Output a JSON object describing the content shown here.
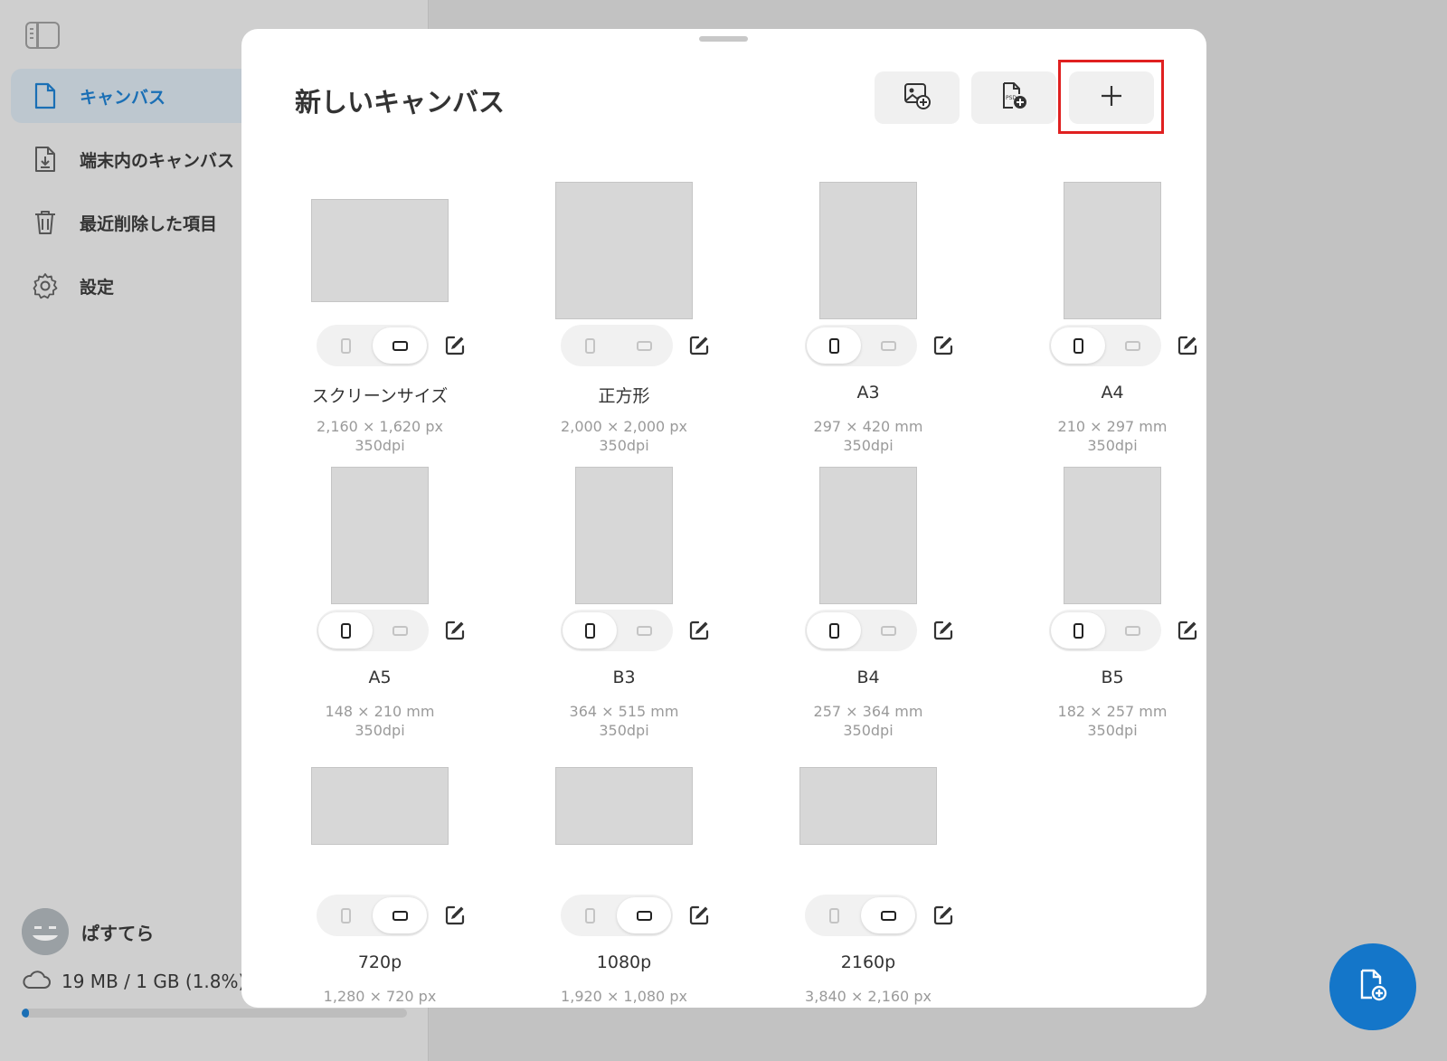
{
  "sidebar": {
    "items": [
      {
        "label": "キャンバス",
        "icon": "document-icon",
        "active": true
      },
      {
        "label": "端末内のキャンバス",
        "icon": "download-document-icon",
        "active": false
      },
      {
        "label": "最近削除した項目",
        "icon": "trash-icon",
        "active": false
      },
      {
        "label": "設定",
        "icon": "gear-icon",
        "active": false
      }
    ],
    "user": {
      "name": "ぱすてら"
    },
    "storage": {
      "text": "19 MB / 1 GB (1.8%)",
      "percent": 1.8
    }
  },
  "modal": {
    "title": "新しいキャンバス",
    "header_buttons": [
      {
        "icon": "image-add-icon"
      },
      {
        "icon": "psd-add-icon"
      },
      {
        "icon": "plus-icon"
      }
    ],
    "presets": [
      {
        "name": "スクリーンサイズ",
        "size": "2,160 × 1,620 px",
        "dpi": "350dpi",
        "orientation": "landscape"
      },
      {
        "name": "正方形",
        "size": "2,000 × 2,000 px",
        "dpi": "350dpi",
        "orientation": "none"
      },
      {
        "name": "A3",
        "size": "297 × 420 mm",
        "dpi": "350dpi",
        "orientation": "portrait"
      },
      {
        "name": "A4",
        "size": "210 × 297 mm",
        "dpi": "350dpi",
        "orientation": "portrait"
      },
      {
        "name": "A5",
        "size": "148 × 210 mm",
        "dpi": "350dpi",
        "orientation": "portrait"
      },
      {
        "name": "B3",
        "size": "364 × 515 mm",
        "dpi": "350dpi",
        "orientation": "portrait"
      },
      {
        "name": "B4",
        "size": "257 × 364 mm",
        "dpi": "350dpi",
        "orientation": "portrait"
      },
      {
        "name": "B5",
        "size": "182 × 257 mm",
        "dpi": "350dpi",
        "orientation": "portrait"
      },
      {
        "name": "720p",
        "size": "1,280 × 720 px",
        "dpi": "",
        "orientation": "landscape"
      },
      {
        "name": "1080p",
        "size": "1,920 × 1,080 px",
        "dpi": "",
        "orientation": "landscape"
      },
      {
        "name": "2160p",
        "size": "3,840 × 2,160 px",
        "dpi": "",
        "orientation": "landscape"
      }
    ]
  },
  "colors": {
    "accent": "#1476c9",
    "highlight": "#e02020"
  }
}
